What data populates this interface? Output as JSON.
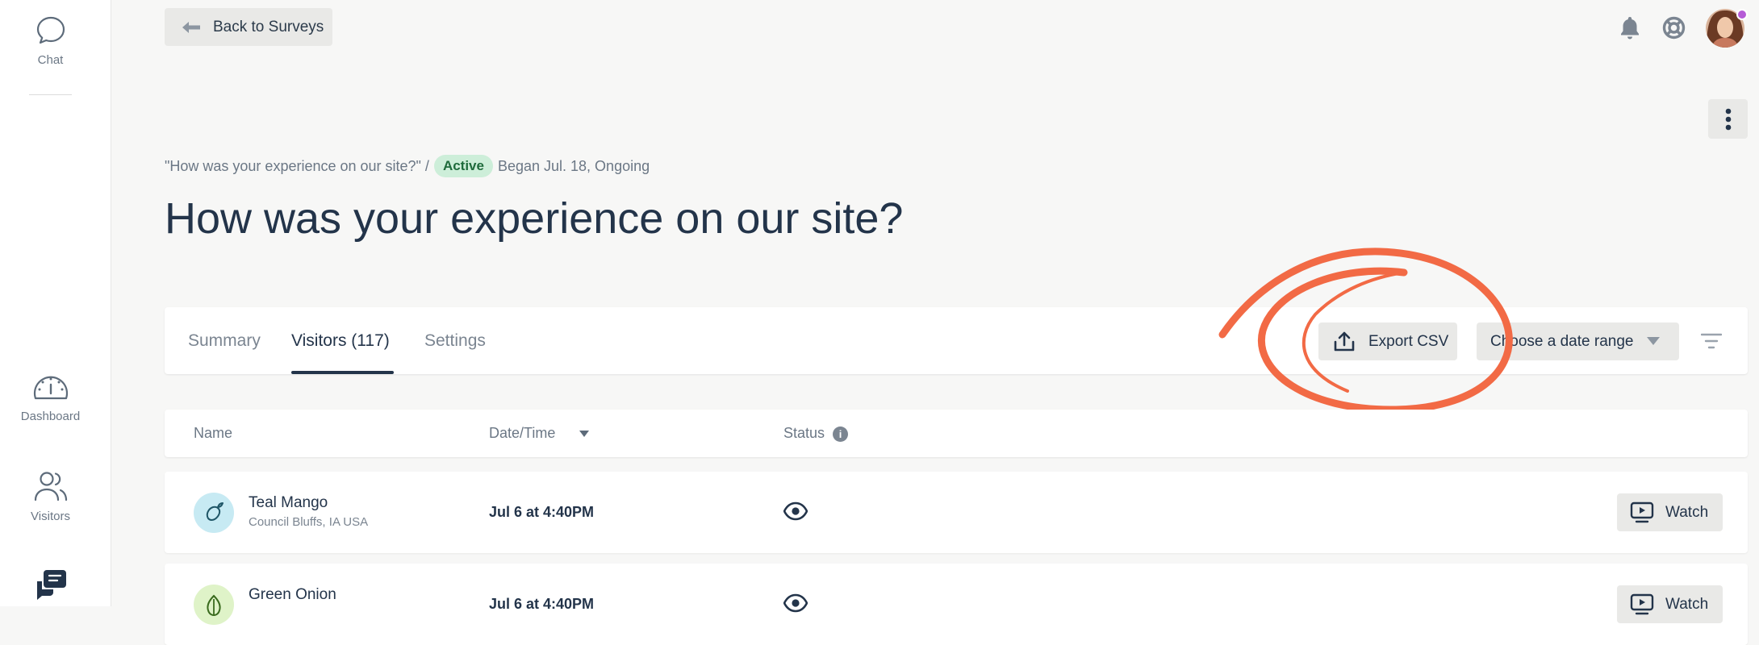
{
  "sidebar": {
    "items": [
      {
        "label": "Chat",
        "icon": "chat-bubble-icon"
      },
      {
        "label": "Dashboard",
        "icon": "gauge-icon"
      },
      {
        "label": "Visitors",
        "icon": "people-icon"
      },
      {
        "label": "",
        "icon": "surveys-icon"
      }
    ]
  },
  "header": {
    "back_label": "Back to Surveys",
    "icons": [
      "bell-icon",
      "lifebuoy-icon",
      "user-avatar",
      "more-vertical-icon"
    ],
    "notification_color": "#b55bd6"
  },
  "survey": {
    "crumb_quote": "\"How was your experience on our site?\" /",
    "status_badge": "Active",
    "began": "Began Jul. 18, Ongoing",
    "title": "How was your experience on our site?"
  },
  "tabs": [
    {
      "label": "Summary",
      "active": false
    },
    {
      "label": "Visitors (117)",
      "active": true
    },
    {
      "label": "Settings",
      "active": false
    }
  ],
  "toolbar": {
    "export_label": "Export CSV",
    "date_range_placeholder": "Choose a date range",
    "annotation_color": "#f26a45"
  },
  "table": {
    "columns": [
      "Name",
      "Date/Time",
      "Status"
    ],
    "rows": [
      {
        "name": "Teal Mango",
        "location": "Council Bluffs, IA USA",
        "datetime": "Jul 6 at 4:40PM",
        "status_icon": "eye-icon",
        "action": "Watch"
      },
      {
        "name": "Green Onion",
        "location": "",
        "datetime": "Jul 6 at 4:40PM",
        "status_icon": "eye-icon",
        "action": "Watch"
      }
    ]
  }
}
